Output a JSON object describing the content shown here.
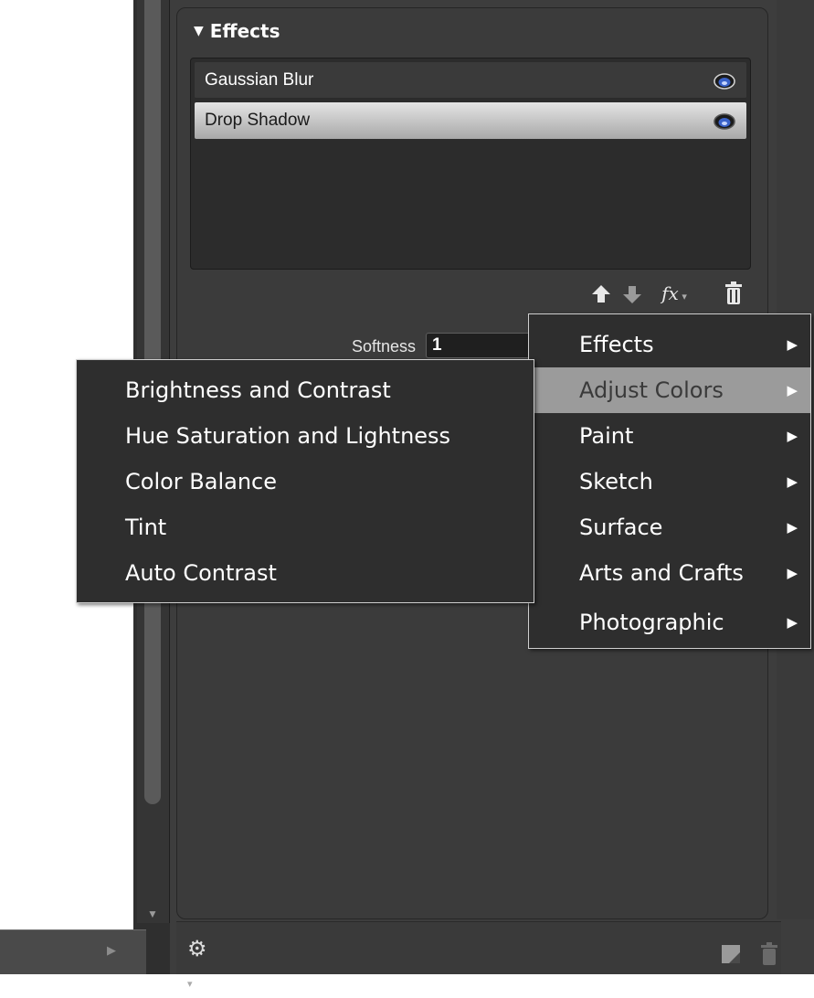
{
  "panel": {
    "section_title": "Effects",
    "section_arrow": "▼",
    "effects": [
      {
        "label": "Gaussian Blur",
        "selected": false
      },
      {
        "label": "Drop Shadow",
        "selected": true
      }
    ],
    "toolbar": {
      "fx_label": "fx"
    },
    "softness": {
      "label": "Softness",
      "value": "1"
    }
  },
  "menu": {
    "items": [
      {
        "label": "Effects",
        "active": false
      },
      {
        "label": "Adjust Colors",
        "active": true
      },
      {
        "label": "Paint",
        "active": false
      },
      {
        "label": "Sketch",
        "active": false
      },
      {
        "label": "Surface",
        "active": false
      },
      {
        "label": "Arts and Crafts",
        "active": false
      },
      {
        "label": "Photographic",
        "active": false
      }
    ]
  },
  "submenu": {
    "items": [
      {
        "label": "Brightness and Contrast"
      },
      {
        "label": "Hue Saturation and Lightness"
      },
      {
        "label": "Color Balance"
      },
      {
        "label": "Tint"
      },
      {
        "label": "Auto Contrast"
      }
    ]
  },
  "icons": {
    "eye": "eye-icon",
    "up": "arrow-up-icon",
    "down": "arrow-down-icon",
    "fx": "fx-icon",
    "trash": "trash-icon",
    "gear": "gear-icon",
    "new_layer": "new-layer-icon"
  },
  "colors": {
    "menu_active_bg": "#9b9b9b",
    "selected_row_top": "#e4e4e4",
    "selected_row_bottom": "#a8a8a8",
    "eye_blue": "#3a62c8"
  }
}
